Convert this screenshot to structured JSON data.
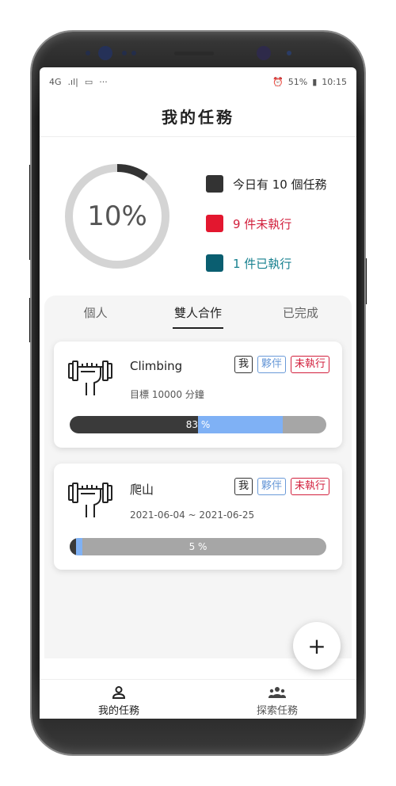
{
  "status": {
    "left_network": "4G",
    "left_signal": ".ıl|",
    "left_more": "···",
    "right_battery": "51%",
    "right_time": "10:15"
  },
  "header": {
    "title": "我的任務"
  },
  "summary": {
    "percent_label": "10%",
    "progress": 0.1,
    "legend": [
      {
        "text": "今日有 10 個任務",
        "color": "#333333"
      },
      {
        "text": "9 件未執行",
        "color": "#e3172f"
      },
      {
        "text": "1 件已執行",
        "color": "#0a5e70"
      }
    ]
  },
  "tabs": [
    {
      "label": "個人"
    },
    {
      "label": "雙人合作"
    },
    {
      "label": "已完成"
    }
  ],
  "tasks": [
    {
      "title": "Climbing",
      "subtitle": "目標 10000 分鐘",
      "badges": [
        "我",
        "夥伴",
        "未執行"
      ],
      "progress_label": "83 %",
      "self_fraction": 0.5,
      "partner_fraction": 0.83
    },
    {
      "title": "爬山",
      "subtitle": "2021-06-04 ~ 2021-06-25",
      "badges": [
        "我",
        "夥伴",
        "未執行"
      ],
      "progress_label": "5 %",
      "self_fraction": 0.025,
      "partner_fraction": 0.05
    }
  ],
  "fab": {
    "label": "+"
  },
  "bottom_nav": [
    {
      "label": "我的任務",
      "icon": "person-icon"
    },
    {
      "label": "探索任務",
      "icon": "group-icon"
    }
  ],
  "colors": {
    "legend_text_primary": "#222222",
    "legend_text_pending": "#d21f3c",
    "legend_text_done": "#16808f"
  }
}
